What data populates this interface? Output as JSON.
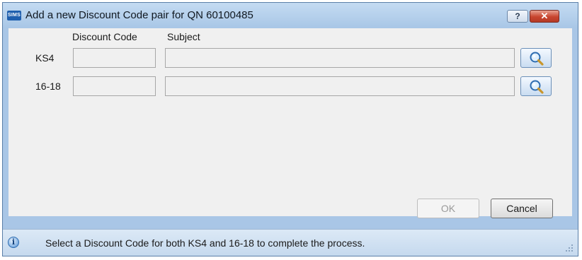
{
  "window": {
    "title": "Add a new Discount Code pair for QN 60100485",
    "app_icon_text": "SIMS",
    "help_label": "?",
    "close_label": "✕"
  },
  "columns": {
    "discount_code": "Discount Code",
    "subject": "Subject"
  },
  "rows": [
    {
      "label": "KS4",
      "discount_code_value": "",
      "subject_value": ""
    },
    {
      "label": "16-18",
      "discount_code_value": "",
      "subject_value": ""
    }
  ],
  "buttons": {
    "ok": "OK",
    "cancel": "Cancel"
  },
  "status": {
    "message": "Select a Discount Code for both KS4 and 16-18 to complete the process.",
    "icon": "info-icon"
  }
}
